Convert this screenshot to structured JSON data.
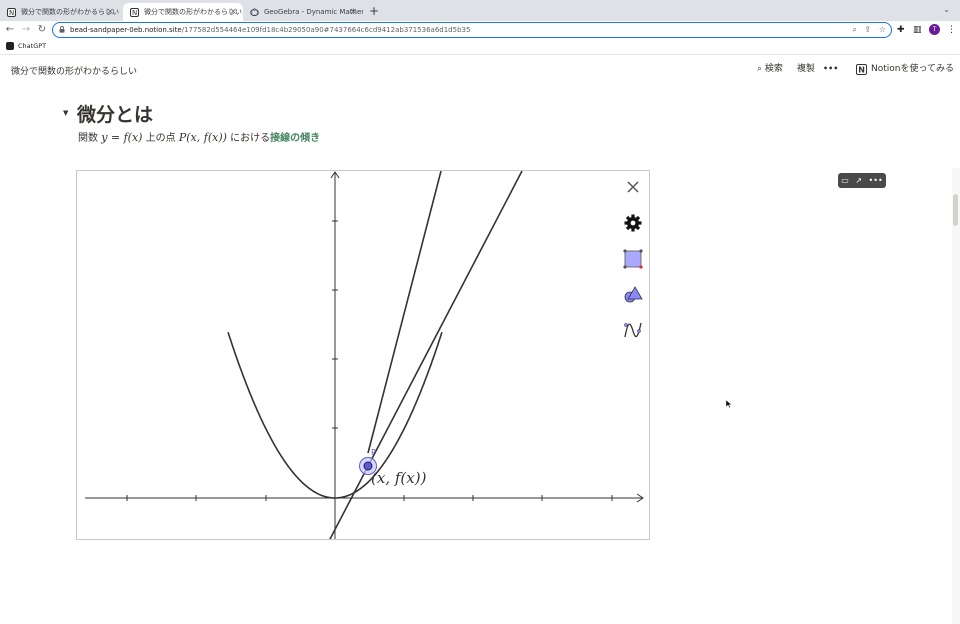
{
  "browser": {
    "tabs": [
      {
        "title": "微分で関数の形がわかるらしい",
        "active": false
      },
      {
        "title": "微分で関数の形がわかるらしい",
        "active": true
      },
      {
        "title": "GeoGebra - Dynamic Mathem",
        "active": false
      }
    ],
    "new_tab": "+",
    "close_glyph": "×",
    "url_host": "bead-sandpaper-0eb.notion.site",
    "url_path": "/177582d554464e109fd18c4b29050a90#7437664c6cd9412ab371536a6d1d5b35",
    "avatar_letter": "T",
    "bookmarks": [
      {
        "label": "ChatGPT"
      }
    ]
  },
  "notion": {
    "page_title": "微分で関数の形がわかるらしい",
    "search_label": "検索",
    "duplicate_label": "複製",
    "more_label": "•••",
    "try_label": "Notionを使ってみる"
  },
  "content": {
    "heading": "微分とは",
    "para": {
      "prefix": "関数",
      "math1": "y = f(x)",
      "mid": "上の点",
      "math2": "P(x, f(x))",
      "suffix": "における",
      "highlight": "接線の傾き"
    }
  },
  "geogebra": {
    "point_label": "P",
    "point_annotation": "(x, f(x))",
    "tools": [
      "settings-icon",
      "polygon-tool-icon",
      "shapes-tool-icon",
      "function-tool-icon"
    ],
    "close_glyph": "✕"
  },
  "colors": {
    "accent_blue": "#1a73e8",
    "highlight_green": "#448361",
    "point_fill": "#5c5ccc",
    "polygon_fill": "#a9a9ff"
  }
}
